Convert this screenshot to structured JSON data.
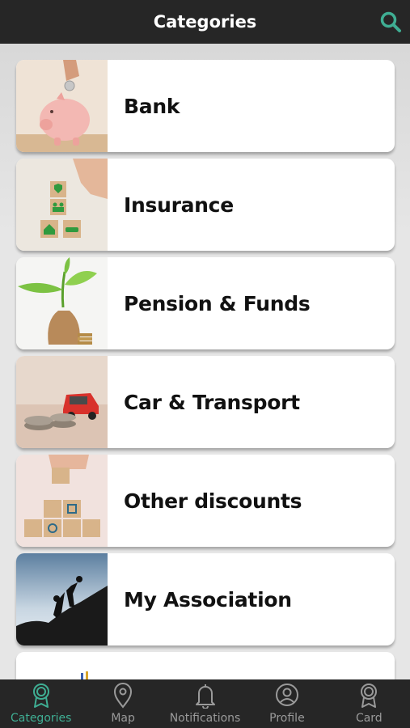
{
  "header": {
    "title": "Categories",
    "search_icon": "search-icon",
    "accent_color": "#3fae93",
    "bar_color": "#262626"
  },
  "categories": [
    {
      "label": "Bank",
      "image": "piggy-bank-photo"
    },
    {
      "label": "Insurance",
      "image": "insurance-blocks-photo"
    },
    {
      "label": "Pension & Funds",
      "image": "plant-money-bag-photo"
    },
    {
      "label": "Car & Transport",
      "image": "toy-car-coins-photo"
    },
    {
      "label": "Other discounts",
      "image": "discount-blocks-photo"
    },
    {
      "label": "My Association",
      "image": "climbers-silhouette-photo"
    }
  ],
  "bottom_nav": {
    "items": [
      {
        "label": "Categories",
        "icon": "badge-icon",
        "active": true
      },
      {
        "label": "Map",
        "icon": "map-pin-icon",
        "active": false
      },
      {
        "label": "Notifications",
        "icon": "bell-icon",
        "active": false
      },
      {
        "label": "Profile",
        "icon": "user-icon",
        "active": false
      },
      {
        "label": "Card",
        "icon": "card-badge-icon",
        "active": false
      }
    ]
  }
}
